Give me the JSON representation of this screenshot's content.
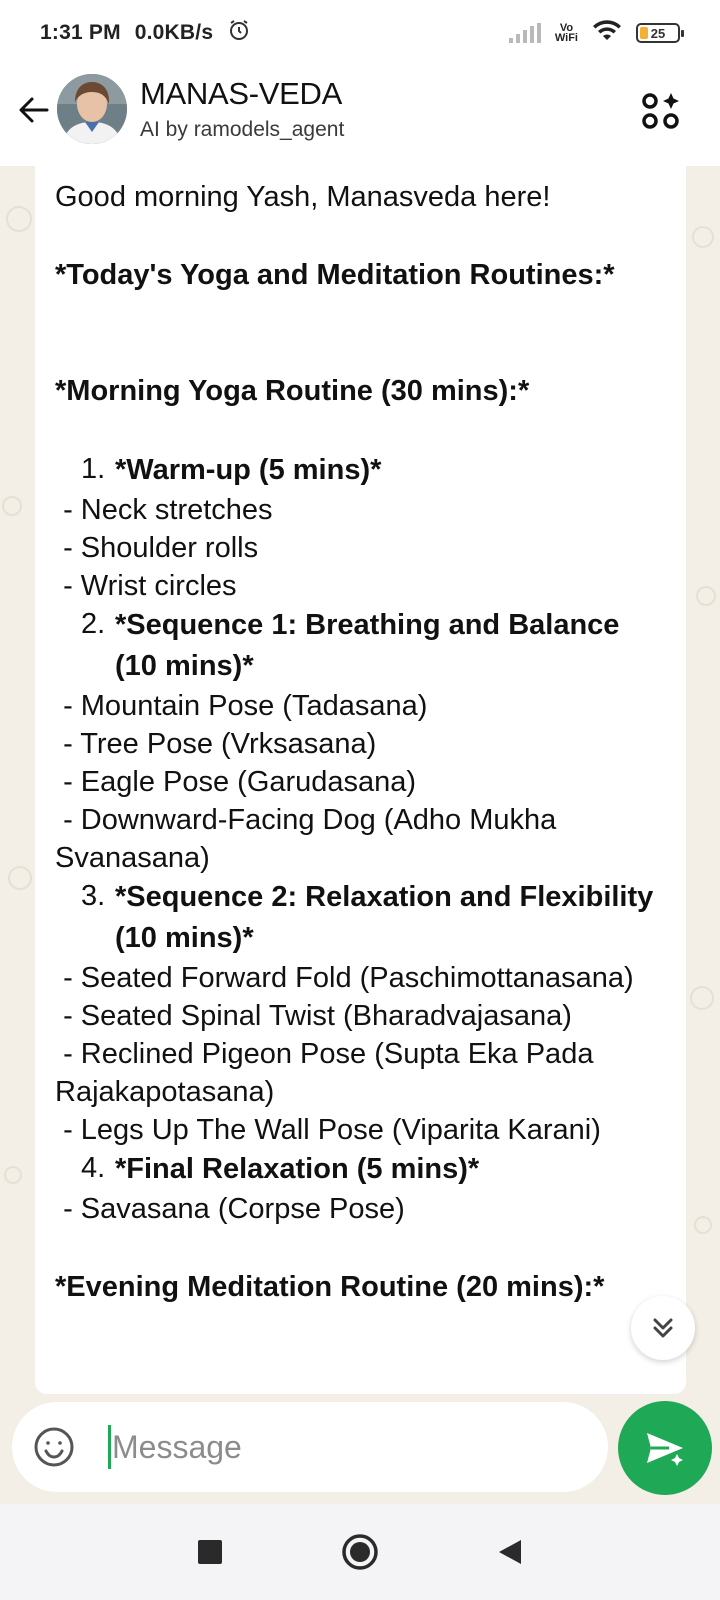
{
  "status_bar": {
    "time": "1:31 PM",
    "net_speed": "0.0KB/s",
    "alarm_icon": "alarm-clock-icon",
    "vowifi_top": "Vo",
    "vowifi_bottom": "WiFi",
    "battery_level": "25",
    "battery_color": "#f2b134"
  },
  "header": {
    "back_icon": "arrow-left-icon",
    "title": "MANAS-VEDA",
    "subtitle": "AI by ramodels_agent",
    "ai_icon": "ai-sparkle-icon"
  },
  "message": {
    "greeting": "Good morning Yash, Manasveda here!",
    "heading": "*Today's Yoga and Meditation Routines:*",
    "morning_heading": "*Morning Yoga Routine (30 mins):*",
    "items": [
      {
        "number": "1.",
        "title": "*Warm-up (5 mins)*"
      },
      {
        "number": "2.",
        "title": "*Sequence 1: Breathing and Balance (10 mins)*"
      },
      {
        "number": "3.",
        "title": "*Sequence 2: Relaxation and Flexibility (10 mins)*"
      },
      {
        "number": "4.",
        "title": "*Final Relaxation (5 mins)*"
      }
    ],
    "warmup_lines": [
      " - Neck stretches",
      " - Shoulder rolls",
      " - Wrist circles"
    ],
    "seq1_lines": [
      " - Mountain Pose (Tadasana)",
      " - Tree Pose (Vrksasana)",
      " - Eagle Pose (Garudasana)",
      " - Downward-Facing Dog (Adho Mukha Svanasana)"
    ],
    "seq2_lines": [
      " - Seated Forward Fold (Paschimottanasana)",
      " - Seated Spinal Twist (Bharadvajasana)",
      " - Reclined Pigeon Pose (Supta Eka Pada Rajakapotasana)",
      " - Legs Up The Wall Pose (Viparita Karani)"
    ],
    "final_lines": [
      " - Savasana (Corpse Pose)"
    ],
    "evening_heading": "*Evening Meditation Routine (20 mins):*"
  },
  "composer": {
    "placeholder": "Message",
    "emoji_icon": "emoji-smile-icon",
    "send_icon": "send-ai-icon",
    "accent": "#1fa855"
  },
  "navbar": {
    "recents_icon": "square-recents-icon",
    "home_icon": "circle-home-icon",
    "back_icon": "triangle-back-icon"
  }
}
